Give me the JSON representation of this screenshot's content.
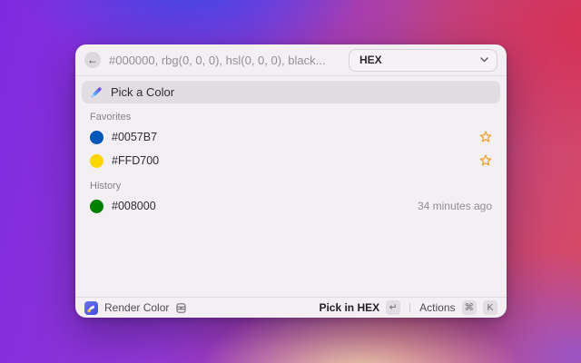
{
  "search": {
    "placeholder": "#000000, rbg(0, 0, 0), hsl(0, 0, 0), black..."
  },
  "format_dropdown": {
    "value": "HEX"
  },
  "pick_row": {
    "label": "Pick a Color"
  },
  "sections": [
    {
      "title": "Favorites",
      "items": [
        {
          "label": "#0057B7",
          "swatch": "#0057B7",
          "accessory": "favorite-star"
        },
        {
          "label": "#FFD700",
          "swatch": "#FFD700",
          "accessory": "favorite-star"
        }
      ]
    },
    {
      "title": "History",
      "items": [
        {
          "label": "#008000",
          "swatch": "#008000",
          "accessory_text": "34 minutes ago"
        }
      ]
    }
  ],
  "footer": {
    "app_name": "Render Color",
    "primary_action_label": "Pick in HEX",
    "primary_action_key": "↵",
    "actions_label": "Actions",
    "actions_keys": [
      "⌘",
      "K"
    ]
  },
  "colors": {
    "star": "#F0A32C",
    "window_bg": "#F3EFF3",
    "selected_row_bg": "#E2DDE2"
  }
}
